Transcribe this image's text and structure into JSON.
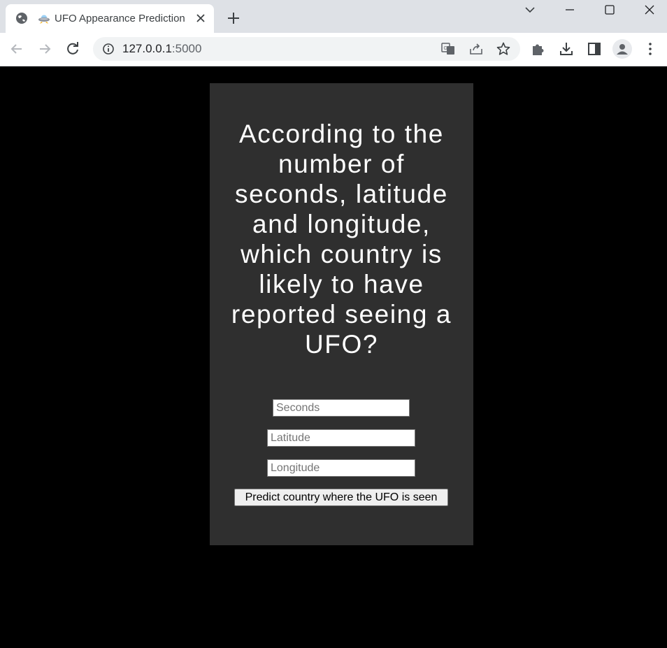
{
  "browser": {
    "tab_title": "UFO Appearance Prediction",
    "url_host": "127.0.0.1",
    "url_port": ":5000"
  },
  "page": {
    "headline": "According to the number of seconds, latitude and longitude, which country is likely to have reported seeing a UFO?",
    "seconds_placeholder": "Seconds",
    "latitude_placeholder": "Latitude",
    "longitude_placeholder": "Longitude",
    "submit_label": "Predict country where the UFO is seen"
  },
  "colors": {
    "background": "#000000",
    "card": "#2f2f2f",
    "headline_text": "#ffffff",
    "chrome_tabstrip": "#dee1e6"
  },
  "icons": {
    "tab_globe": "globe-icon",
    "tab_favicon": "ufo-icon",
    "tab_close": "close-icon",
    "new_tab": "plus-icon",
    "tab_search": "chevron-down-icon",
    "minimize": "minimize-icon",
    "maximize": "maximize-icon",
    "window_close": "close-icon",
    "back": "back-arrow-icon",
    "forward": "forward-arrow-icon",
    "reload": "reload-icon",
    "site_info": "info-icon",
    "translate": "translate-icon",
    "share": "share-icon",
    "bookmark": "star-icon",
    "extensions": "puzzle-icon",
    "downloads": "download-icon",
    "side_panel": "side-panel-icon",
    "profile": "profile-icon",
    "menu": "kebab-menu-icon"
  }
}
